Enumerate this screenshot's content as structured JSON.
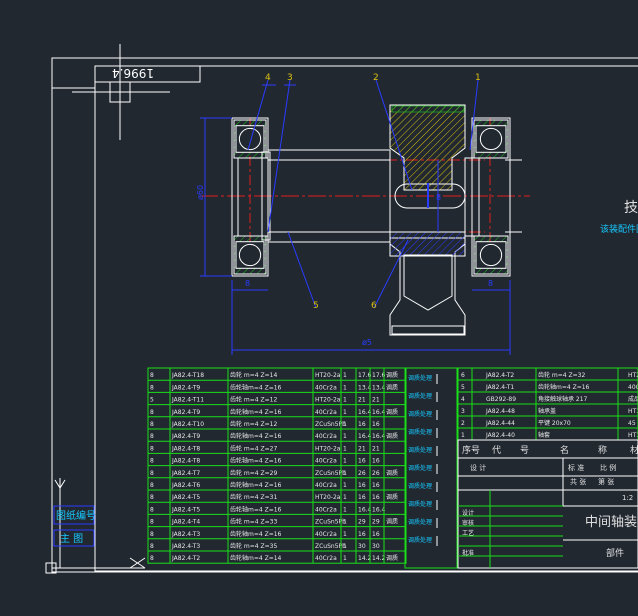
{
  "window": {
    "background": "#212830"
  },
  "colors": {
    "frame": "#ffffff",
    "part": "#ffffff",
    "hatch": "#d8c010",
    "bearing": "#1fb81f",
    "center": "#e02020",
    "dim": "#2a3cff",
    "leader": "#2a3cff",
    "table": "#19e019",
    "table_text": "#e8e8e8",
    "title_text": "#e0e0e0",
    "cyan_text": "#18c8ff"
  },
  "title_stamp": {
    "text": "1996.4"
  },
  "balloons": [
    "4",
    "3",
    "2",
    "1",
    "5",
    "6"
  ],
  "dimensions": {
    "overall_length": "ø5",
    "left_height": "ø60",
    "bore_height": "8",
    "left_width": "8",
    "right_width": "8"
  },
  "right_cut_text": {
    "char": "技",
    "sub": "该装配件图"
  },
  "bottom_left_labels": {
    "label1": "图纸编号",
    "label2": "主  图"
  },
  "parts_left": [
    {
      "no": "8",
      "code": "JA82.4-T18",
      "name": "齿轮  m=4 Z=14",
      "mat": "HT20-2a",
      "qty": "1",
      "w1": "17.6",
      "w2": "17.6",
      "note": "调质"
    },
    {
      "no": "8",
      "code": "JA82.4-T9",
      "name": "齿轮轴m=4 Z=16",
      "mat": "40Cr2a",
      "qty": "1",
      "w1": "13.4",
      "w2": "13.4",
      "note": "调质"
    },
    {
      "no": "5",
      "code": "JA82.4-T11",
      "name": "齿轮  m=4 Z=12",
      "mat": "HT20-2a",
      "qty": "1",
      "w1": "21",
      "w2": "21",
      "note": ""
    },
    {
      "no": "8",
      "code": "JA82.4-T9",
      "name": "齿轮轴m=4 Z=16",
      "mat": "40Cr2a",
      "qty": "1",
      "w1": "16.4",
      "w2": "16.4",
      "note": "调质"
    },
    {
      "no": "8",
      "code": "JA82.4-T10",
      "name": "齿轮  m=4 Z=12",
      "mat": "ZCuSn5Pb",
      "qty": "1",
      "w1": "16",
      "w2": "16",
      "note": ""
    },
    {
      "no": "8",
      "code": "JA82.4-T9",
      "name": "齿轮轴m=4 Z=16",
      "mat": "40Cr2a",
      "qty": "1",
      "w1": "16.4",
      "w2": "16.4",
      "note": "调质"
    },
    {
      "no": "8",
      "code": "JA82.4-T8",
      "name": "齿轮  m=4 Z=27",
      "mat": "HT20-2a",
      "qty": "1",
      "w1": "21",
      "w2": "21",
      "note": ""
    },
    {
      "no": "8",
      "code": "JA82.4-T8",
      "name": "齿轮轴m=4 Z=16",
      "mat": "40Cr2a",
      "qty": "1",
      "w1": "16",
      "w2": "16",
      "note": ""
    },
    {
      "no": "8",
      "code": "JA82.4-T7",
      "name": "齿轮  m=4 Z=29",
      "mat": "ZCuSn5Pb",
      "qty": "1",
      "w1": "26",
      "w2": "26",
      "note": "调质"
    },
    {
      "no": "8",
      "code": "JA82.4-T6",
      "name": "齿轮轴m=4 Z=16",
      "mat": "40Cr2a",
      "qty": "1",
      "w1": "16",
      "w2": "16",
      "note": ""
    },
    {
      "no": "8",
      "code": "JA82.4-T5",
      "name": "齿轮  m=4 Z=31",
      "mat": "HT20-2a",
      "qty": "1",
      "w1": "16",
      "w2": "16",
      "note": "调质"
    },
    {
      "no": "8",
      "code": "JA82.4-T5",
      "name": "齿轮轴m=4 Z=16",
      "mat": "40Cr2a",
      "qty": "1",
      "w1": "16.4",
      "w2": "16.4",
      "note": ""
    },
    {
      "no": "8",
      "code": "JA82.4-T4",
      "name": "齿轮  m=4 Z=33",
      "mat": "ZCuSn5Pb",
      "qty": "1",
      "w1": "29",
      "w2": "29",
      "note": "调质"
    },
    {
      "no": "8",
      "code": "JA82.4-T3",
      "name": "齿轮轴m=4 Z=16",
      "mat": "40Cr2a",
      "qty": "1",
      "w1": "16",
      "w2": "16",
      "note": ""
    },
    {
      "no": "8",
      "code": "JA82.4-T3",
      "name": "齿轮  m=4 Z=35",
      "mat": "ZCuSn5Pb",
      "qty": "1",
      "w1": "30",
      "w2": "30",
      "note": ""
    },
    {
      "no": "8",
      "code": "JA82.4-T2",
      "name": "齿轮轴m=4 Z=14",
      "mat": "40Cr2a",
      "qty": "1",
      "w1": "14.2",
      "w2": "14.2",
      "note": "调质"
    }
  ],
  "parts_right": [
    {
      "no": "6",
      "code": "JA82.4-T2",
      "name": "齿轮  m=4 Z=32",
      "mat": "HT20"
    },
    {
      "no": "5",
      "code": "JA82.4-T1",
      "name": "齿轮轴m=4 Z=16",
      "mat": "40Cr"
    },
    {
      "no": "4",
      "code": "GB292-89",
      "name": "角接触球轴承 217",
      "mat": "成品"
    },
    {
      "no": "3",
      "code": "JA82.4-48",
      "name": "轴承盖",
      "mat": "HT15"
    },
    {
      "no": "2",
      "code": "JA82.4-44",
      "name": "平键 20x70",
      "mat": "45"
    },
    {
      "no": "1",
      "code": "JA82.4-40",
      "name": "轴套",
      "mat": "HT15"
    }
  ],
  "header_row": {
    "c1": "序号",
    "c2": "代",
    "c3": "号",
    "c4": "名",
    "c5": "称",
    "c6": "材料"
  },
  "title_block": {
    "title": "中间轴装配",
    "r1a": "设 计",
    "r1b": "标 准",
    "r1c": "比 例",
    "r2a": "共  张",
    "r2b": "第  张",
    "r2c": "重量",
    "scale": "1:2",
    "sign1": "设计",
    "sign2": "审核",
    "sign3": "工艺",
    "sign4": "批准",
    "sub": "部件"
  }
}
